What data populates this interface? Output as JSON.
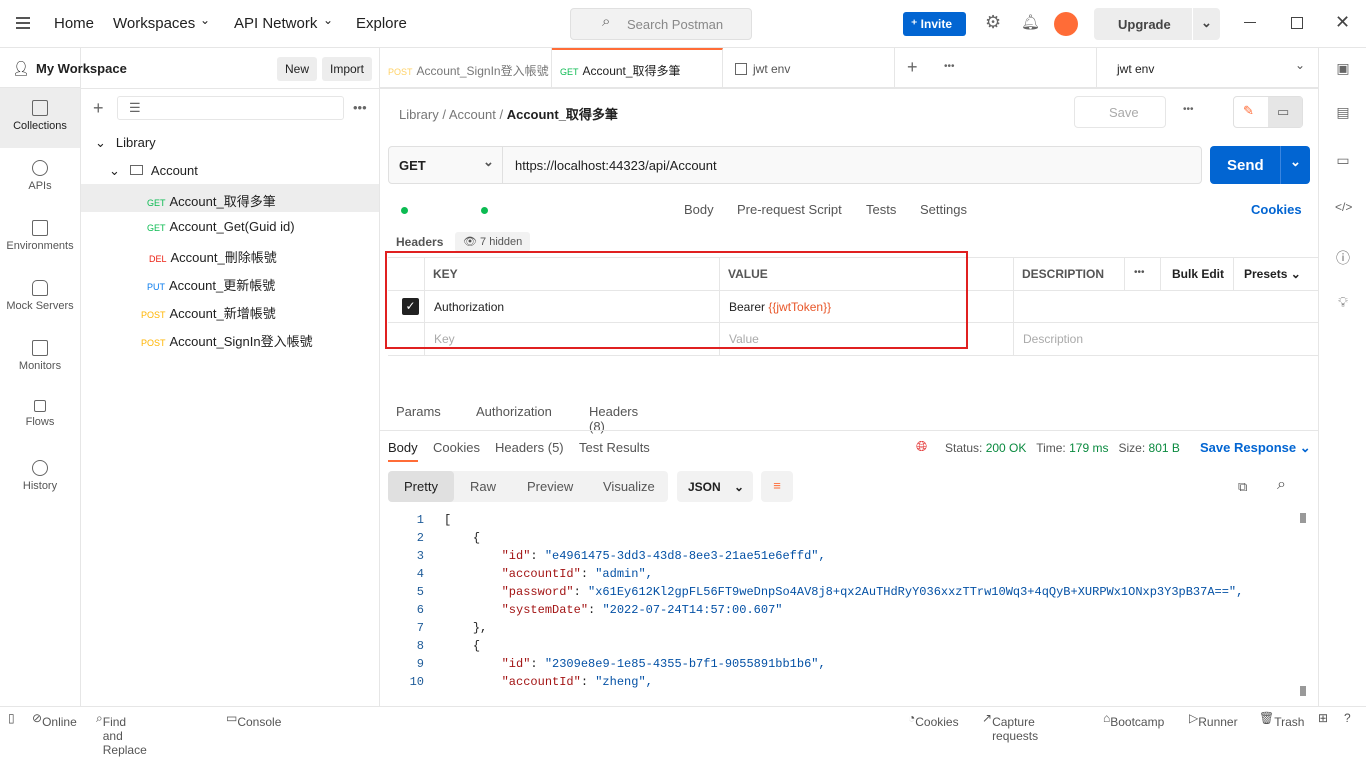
{
  "topbar": {
    "nav": [
      "Home",
      "Workspaces",
      "API Network",
      "Explore"
    ],
    "search_placeholder": "Search Postman",
    "invite": "Invite",
    "upgrade": "Upgrade"
  },
  "workspace": {
    "name": "My Workspace",
    "new": "New",
    "import": "Import"
  },
  "rail": [
    {
      "label": "Collections",
      "icon": "collections-icon"
    },
    {
      "label": "APIs",
      "icon": "apis-icon"
    },
    {
      "label": "Environments",
      "icon": "environments-icon"
    },
    {
      "label": "Mock Servers",
      "icon": "mock-servers-icon"
    },
    {
      "label": "Monitors",
      "icon": "monitors-icon"
    },
    {
      "label": "Flows",
      "icon": "flows-icon"
    },
    {
      "label": "History",
      "icon": "history-icon"
    }
  ],
  "tree": {
    "collection": "Library",
    "folder": "Account",
    "requests": [
      {
        "method": "GET",
        "name": "Account_取得多筆",
        "selected": true
      },
      {
        "method": "GET",
        "name": "Account_Get(Guid id)"
      },
      {
        "method": "DEL",
        "name": "Account_刪除帳號"
      },
      {
        "method": "PUT",
        "name": "Account_更新帳號"
      },
      {
        "method": "POST",
        "name": "Account_新增帳號"
      },
      {
        "method": "POST",
        "name": "Account_SignIn登入帳號"
      }
    ]
  },
  "tabs": [
    {
      "method": "POST",
      "name": "Account_SignIn登入帳號"
    },
    {
      "method": "GET",
      "name": "Account_取得多筆",
      "active": true
    },
    {
      "name": "jwt env"
    }
  ],
  "environment": "jwt env",
  "breadcrumb": [
    "Library",
    "Account",
    "Account_取得多筆"
  ],
  "save": "Save",
  "request": {
    "method": "GET",
    "url": "https://localhost:44323/api/Account",
    "send": "Send"
  },
  "request_tabs": [
    "Params",
    "Authorization",
    "Headers (8)",
    "Body",
    "Pre-request Script",
    "Tests",
    "Settings"
  ],
  "cookies": "Cookies",
  "headers": {
    "label": "Headers",
    "hidden": "7 hidden",
    "columns": [
      "KEY",
      "VALUE",
      "DESCRIPTION"
    ],
    "bulk_edit": "Bulk Edit",
    "presets": "Presets",
    "rows": [
      {
        "checked": true,
        "key": "Authorization",
        "value_prefix": "Bearer ",
        "value_var": "{{jwtToken}}"
      }
    ],
    "placeholder": {
      "key": "Key",
      "value": "Value",
      "description": "Description"
    }
  },
  "response": {
    "tabs": [
      "Body",
      "Cookies",
      "Headers (5)",
      "Test Results"
    ],
    "status_label": "Status:",
    "status": "200 OK",
    "time_label": "Time:",
    "time": "179 ms",
    "size_label": "Size:",
    "size": "801 B",
    "save_response": "Save Response",
    "views": [
      "Pretty",
      "Raw",
      "Preview",
      "Visualize"
    ],
    "format": "JSON",
    "lines": [
      {
        "n": "1",
        "indent": 0,
        "text": "["
      },
      {
        "n": "2",
        "indent": 1,
        "text": "{"
      },
      {
        "n": "3",
        "indent": 2,
        "key": "\"id\"",
        "val": "\"e4961475-3dd3-43d8-8ee3-21ae51e6effd\","
      },
      {
        "n": "4",
        "indent": 2,
        "key": "\"accountId\"",
        "val": "\"admin\","
      },
      {
        "n": "5",
        "indent": 2,
        "key": "\"password\"",
        "val": "\"x61Ey612Kl2gpFL56FT9weDnpSo4AV8j8+qx2AuTHdRyY036xxzTTrw10Wq3+4qQyB+XURPWx1ONxp3Y3pB37A==\","
      },
      {
        "n": "6",
        "indent": 2,
        "key": "\"systemDate\"",
        "val": "\"2022-07-24T14:57:00.607\""
      },
      {
        "n": "7",
        "indent": 1,
        "text": "},"
      },
      {
        "n": "8",
        "indent": 1,
        "text": "{"
      },
      {
        "n": "9",
        "indent": 2,
        "key": "\"id\"",
        "val": "\"2309e8e9-1e85-4355-b7f1-9055891bb1b6\","
      },
      {
        "n": "10",
        "indent": 2,
        "key": "\"accountId\"",
        "val": "\"zheng\","
      }
    ]
  },
  "statusbar": {
    "left": [
      "Online",
      "Find and Replace",
      "Console"
    ],
    "right": [
      "Cookies",
      "Capture requests",
      "Bootcamp",
      "Runner",
      "Trash"
    ]
  },
  "colors": {
    "accent": "#0265d2",
    "orange": "#ff6c37",
    "highlight": "#e02020"
  }
}
